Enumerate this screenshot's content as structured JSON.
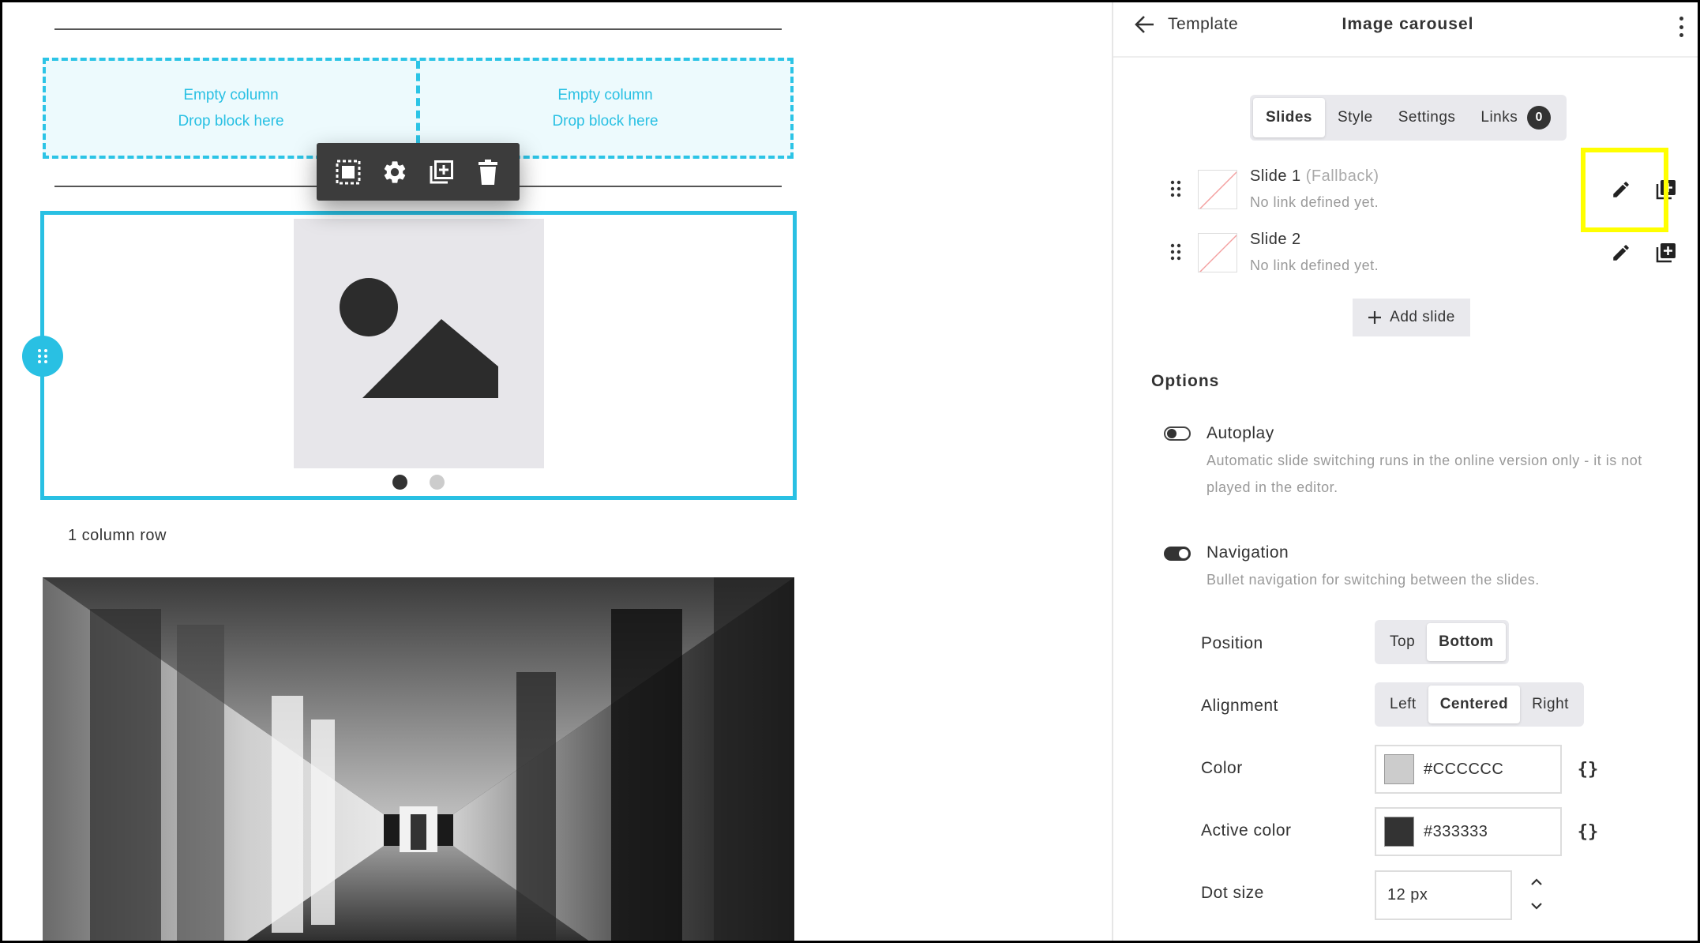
{
  "canvas": {
    "empty_columns": [
      {
        "title": "Empty column",
        "hint": "Drop block here"
      },
      {
        "title": "Empty column",
        "hint": "Drop block here"
      }
    ],
    "toolbar": {
      "icons": [
        "select-parent-icon",
        "gear-icon",
        "duplicate-icon",
        "trash-icon"
      ]
    },
    "carousel": {
      "active_dot": 1,
      "dot_count": 2,
      "dot_color": "#CCCCCC",
      "active_dot_color": "#333333"
    },
    "row_label": "1 column row"
  },
  "panel": {
    "back_label": "Template",
    "title": "Image carousel",
    "tabs": [
      {
        "label": "Slides",
        "active": true
      },
      {
        "label": "Style",
        "active": false
      },
      {
        "label": "Settings",
        "active": false
      },
      {
        "label": "Links",
        "active": false,
        "badge": "0"
      }
    ],
    "slides": [
      {
        "name": "Slide 1",
        "note": "(Fallback)",
        "subtitle": "No link defined yet."
      },
      {
        "name": "Slide 2",
        "note": "",
        "subtitle": "No link defined yet."
      }
    ],
    "add_slide_label": "Add slide",
    "options_title": "Options",
    "autoplay": {
      "label": "Autoplay",
      "enabled": false,
      "description": "Automatic slide switching runs in the online version only - it is not played in the editor."
    },
    "navigation": {
      "label": "Navigation",
      "enabled": true,
      "description": "Bullet navigation for switching between the slides."
    },
    "position": {
      "label": "Position",
      "options": [
        "Top",
        "Bottom"
      ],
      "selected": "Bottom"
    },
    "alignment": {
      "label": "Alignment",
      "options": [
        "Left",
        "Centered",
        "Right"
      ],
      "selected": "Centered"
    },
    "color": {
      "label": "Color",
      "value": "#CCCCCC"
    },
    "active_color": {
      "label": "Active color",
      "value": "#333333"
    },
    "dot_size": {
      "label": "Dot size",
      "value": "12 px"
    }
  }
}
